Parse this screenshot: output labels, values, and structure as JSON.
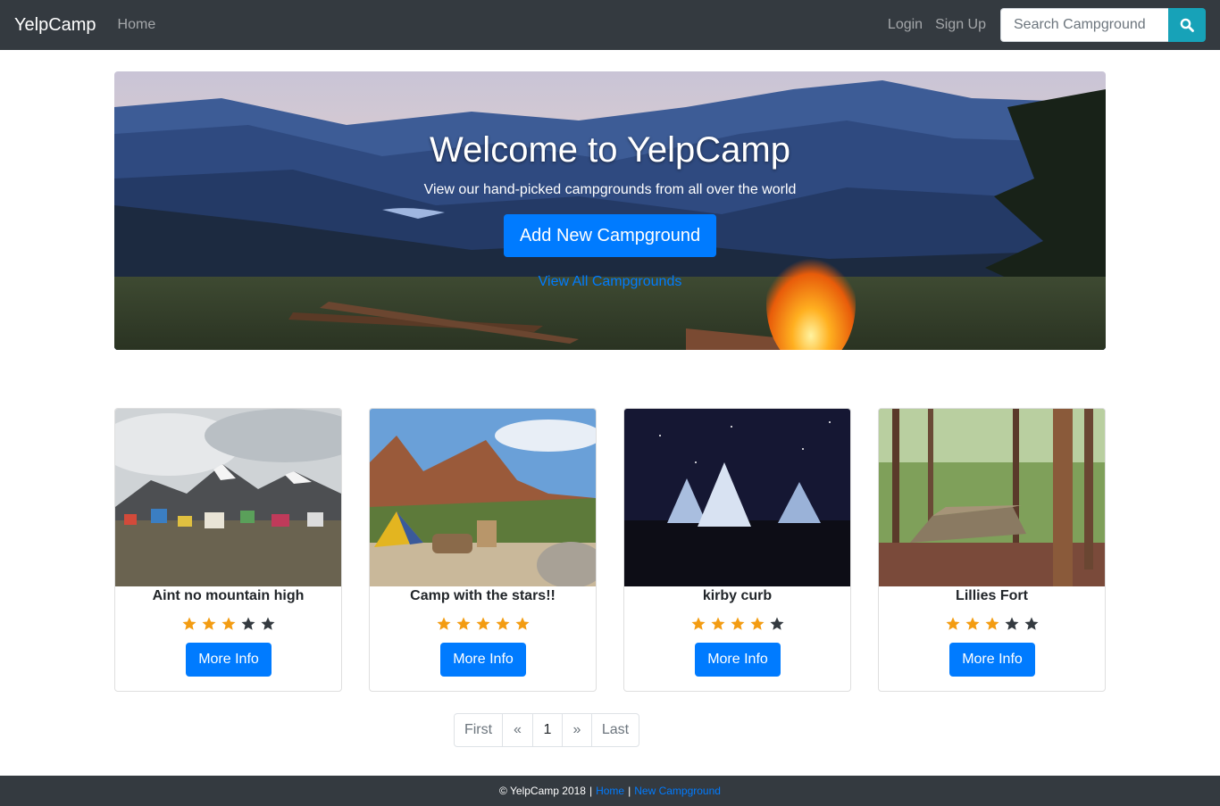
{
  "navbar": {
    "brand": "YelpCamp",
    "home": "Home",
    "login": "Login",
    "signup": "Sign Up",
    "search_placeholder": "Search Campground",
    "search_icon": "search-icon"
  },
  "hero": {
    "title": "Welcome to YelpCamp",
    "subtitle": "View our hand-picked campgrounds from all over the world",
    "add_button": "Add New Campground",
    "view_all": "View All Campgrounds"
  },
  "campgrounds": [
    {
      "name": "Aint no mountain high",
      "rating": 3,
      "button": "More Info"
    },
    {
      "name": "Camp with the stars!!",
      "rating": 5,
      "button": "More Info"
    },
    {
      "name": "kirby curb",
      "rating": 4,
      "button": "More Info"
    },
    {
      "name": "Lillies Fort",
      "rating": 3,
      "button": "More Info"
    }
  ],
  "pagination": {
    "first": "First",
    "prev": "«",
    "current": "1",
    "next": "»",
    "last": "Last"
  },
  "footer": {
    "copyright": "© YelpCamp 2018",
    "sep": "|",
    "home": "Home",
    "new_campground": "New Campground"
  },
  "colors": {
    "navbar": "#343a40",
    "primary": "#007bff",
    "search_button": "#17a2b8",
    "star_filled": "#f39c12",
    "star_empty": "#343a40"
  }
}
